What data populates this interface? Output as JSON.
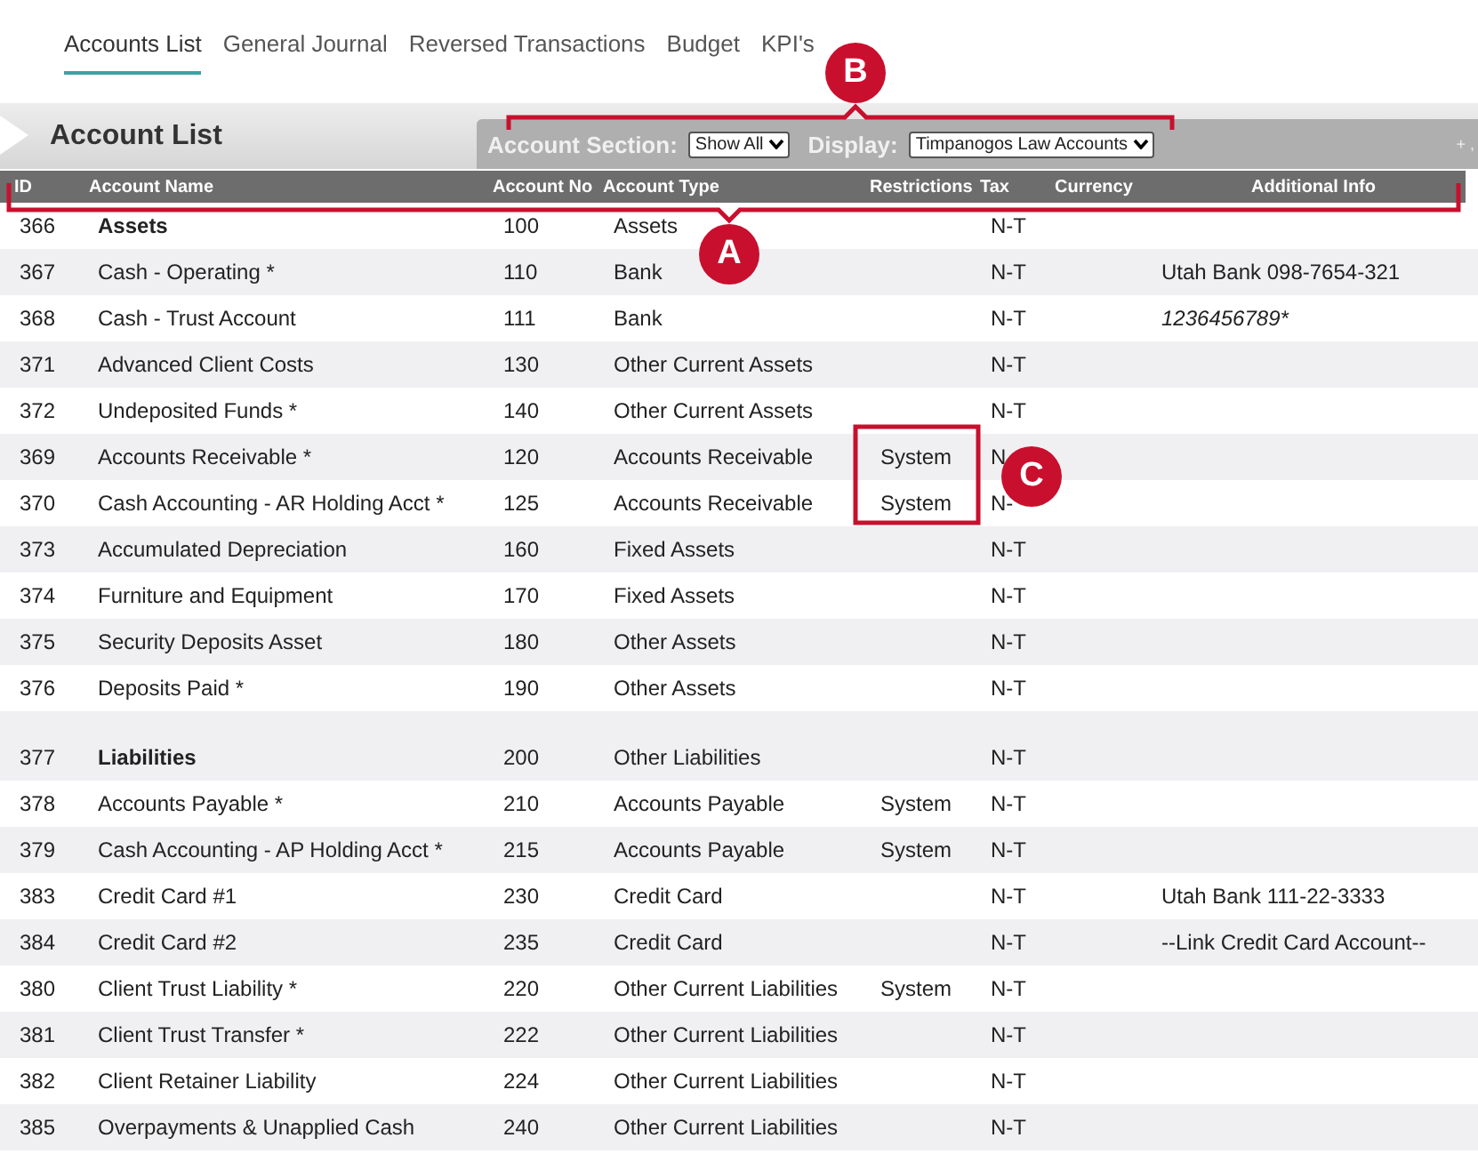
{
  "tabs": [
    {
      "label": "Accounts List",
      "selected": true
    },
    {
      "label": "General Journal",
      "selected": false
    },
    {
      "label": "Reversed Transactions",
      "selected": false
    },
    {
      "label": "Budget",
      "selected": false
    },
    {
      "label": "KPI's",
      "selected": false
    }
  ],
  "panel": {
    "title": "Account List",
    "filters": [
      {
        "label": "Account Section:",
        "value": "Show All"
      },
      {
        "label": "Display:",
        "value": "Timpanogos Law Accounts"
      }
    ],
    "corner": "+ ,"
  },
  "table": {
    "columns": [
      "ID",
      "Account Name",
      "Account No",
      "Account Type",
      "Restrictions",
      "Tax",
      "Currency",
      "Additional Info"
    ],
    "rows": [
      {
        "kind": "section",
        "spaced_before": false,
        "id": "366",
        "name": "Assets",
        "account_no": "100",
        "type": "Assets",
        "tax": "N-T"
      },
      {
        "kind": "account",
        "id": "367",
        "name": "Cash - Operating *",
        "account_no": "110",
        "type": "Bank",
        "tax": "N-T",
        "info": "Utah Bank 098-7654-321",
        "info_italic": false
      },
      {
        "kind": "account",
        "id": "368",
        "name": "Cash - Trust Account",
        "account_no": "111",
        "type": "Bank",
        "tax": "N-T",
        "info": "1236456789*",
        "info_italic": true
      },
      {
        "kind": "account",
        "id": "371",
        "name": "Advanced Client Costs",
        "account_no": "130",
        "type": "Other Current Assets",
        "tax": "N-T"
      },
      {
        "kind": "account",
        "id": "372",
        "name": "Undeposited Funds *",
        "account_no": "140",
        "type": "Other Current Assets",
        "tax": "N-T"
      },
      {
        "kind": "account",
        "id": "369",
        "name": "Accounts Receivable *",
        "account_no": "120",
        "type": "Accounts Receivable",
        "restrictions": "System",
        "tax": "N"
      },
      {
        "kind": "account",
        "id": "370",
        "name": "Cash Accounting - AR Holding Acct *",
        "account_no": "125",
        "type": "Accounts Receivable",
        "restrictions": "System",
        "tax": "N-"
      },
      {
        "kind": "account",
        "id": "373",
        "name": "Accumulated Depreciation",
        "account_no": "160",
        "type": "Fixed Assets",
        "tax": "N-T"
      },
      {
        "kind": "account",
        "id": "374",
        "name": "Furniture and Equipment",
        "account_no": "170",
        "type": "Fixed Assets",
        "tax": "N-T"
      },
      {
        "kind": "account",
        "id": "375",
        "name": "Security Deposits Asset",
        "account_no": "180",
        "type": "Other Assets",
        "tax": "N-T"
      },
      {
        "kind": "account",
        "id": "376",
        "name": "Deposits Paid *",
        "account_no": "190",
        "type": "Other Assets",
        "tax": "N-T"
      },
      {
        "kind": "section",
        "spaced_before": true,
        "id": "377",
        "name": "Liabilities",
        "account_no": "200",
        "type": "Other Liabilities",
        "tax": "N-T"
      },
      {
        "kind": "account",
        "id": "378",
        "name": "Accounts Payable *",
        "account_no": "210",
        "type": "Accounts Payable",
        "restrictions": "System",
        "tax": "N-T"
      },
      {
        "kind": "account",
        "id": "379",
        "name": "Cash Accounting - AP Holding Acct *",
        "account_no": "215",
        "type": "Accounts Payable",
        "restrictions": "System",
        "tax": "N-T"
      },
      {
        "kind": "account",
        "id": "383",
        "name": "Credit Card #1",
        "account_no": "230",
        "type": "Credit Card",
        "tax": "N-T",
        "info": "Utah Bank 111-22-3333",
        "info_italic": false
      },
      {
        "kind": "account",
        "id": "384",
        "name": "Credit Card #2",
        "account_no": "235",
        "type": "Credit Card",
        "tax": "N-T",
        "info": "--Link Credit Card Account--",
        "info_italic": false
      },
      {
        "kind": "account",
        "id": "380",
        "name": "Client Trust Liability *",
        "account_no": "220",
        "type": "Other Current Liabilities",
        "restrictions": "System",
        "tax": "N-T"
      },
      {
        "kind": "account",
        "id": "381",
        "name": "Client Trust Transfer *",
        "account_no": "222",
        "type": "Other Current Liabilities",
        "tax": "N-T"
      },
      {
        "kind": "account",
        "id": "382",
        "name": "Client Retainer Liability",
        "account_no": "224",
        "type": "Other Current Liabilities",
        "tax": "N-T"
      },
      {
        "kind": "account",
        "id": "385",
        "name": "Overpayments & Unapplied Cash",
        "account_no": "240",
        "type": "Other Current Liabilities",
        "tax": "N-T"
      }
    ]
  },
  "callouts": [
    {
      "label": "A"
    },
    {
      "label": "B"
    },
    {
      "label": "C"
    }
  ]
}
